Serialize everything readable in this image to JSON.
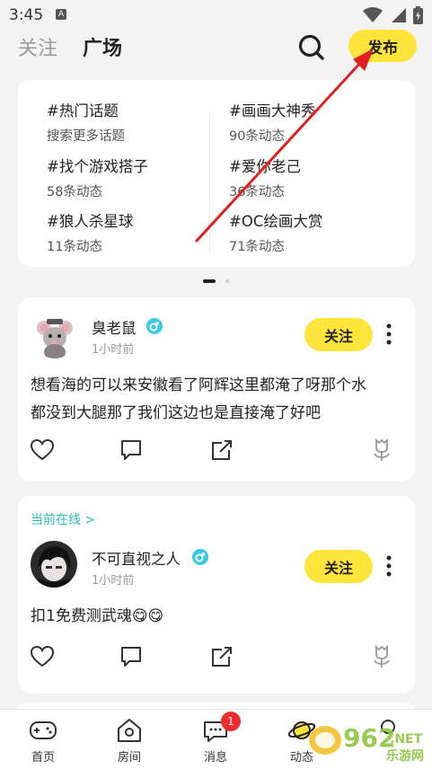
{
  "status_bar": {
    "time": "3:45",
    "a_icon": "A"
  },
  "header": {
    "tab_follow": "关注",
    "tab_square": "广场",
    "publish_label": "发布"
  },
  "topics": [
    {
      "title": "#热门话题",
      "sub": "搜索更多话题"
    },
    {
      "title": "#画画大神秀",
      "sub": "90条动态"
    },
    {
      "title": "#找个游戏搭子",
      "sub": "58条动态"
    },
    {
      "title": "#爱你老己",
      "sub": "36条动态"
    },
    {
      "title": "#狼人杀星球",
      "sub": "11条动态"
    },
    {
      "title": "#OC绘画大赏",
      "sub": "71条动态"
    }
  ],
  "posts": [
    {
      "username": "臭老鼠",
      "time": "1小时前",
      "follow_label": "关注",
      "text_line1": "想看海的可以来安徽看了阿辉这里都淹了呀那个水",
      "text_line2": "都没到大腿那了我们这边也是直接淹了好吧"
    },
    {
      "online": "当前在线 >",
      "username": "不可直视之人",
      "time": "1小时前",
      "follow_label": "关注",
      "text": "扣1免费测武魂😋😋"
    }
  ],
  "bottom_nav": [
    {
      "label": "首页"
    },
    {
      "label": "房间"
    },
    {
      "label": "消息",
      "badge": "1"
    },
    {
      "label": "动态"
    }
  ],
  "watermark": {
    "main": "962",
    "sub": "乐游网",
    "tld": ".NET"
  },
  "colors": {
    "accent_yellow": "#ffe53b",
    "online_green": "#27c1a9",
    "badge_red": "#f02b2b",
    "arrow_red": "#e02020"
  }
}
